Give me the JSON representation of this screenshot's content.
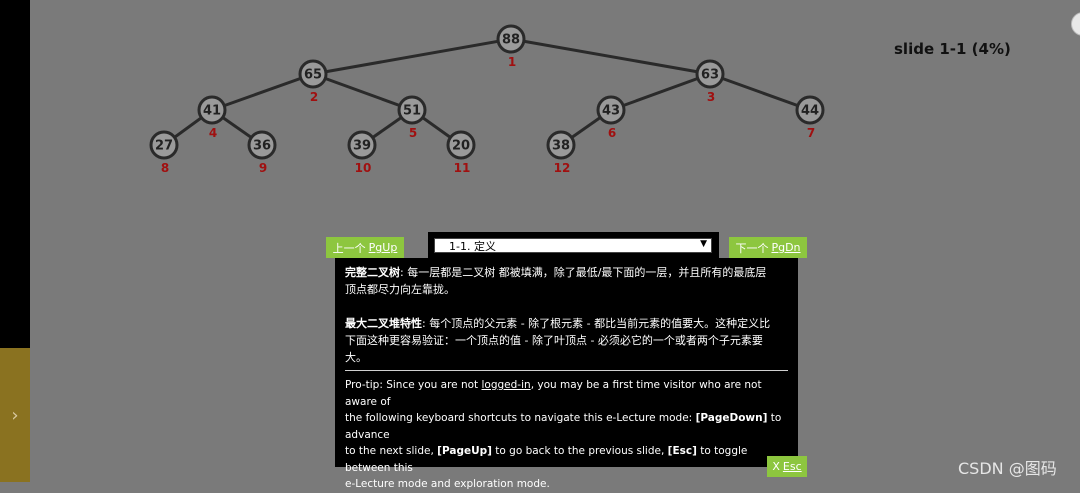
{
  "side_tab": {
    "icon": "chevron-right-icon",
    "glyph": "›"
  },
  "heap": {
    "nodes": [
      {
        "value": "88",
        "index": "1"
      },
      {
        "value": "65",
        "index": "2"
      },
      {
        "value": "63",
        "index": "3"
      },
      {
        "value": "41",
        "index": "4"
      },
      {
        "value": "51",
        "index": "5"
      },
      {
        "value": "43",
        "index": "6"
      },
      {
        "value": "44",
        "index": "7"
      },
      {
        "value": "27",
        "index": "8"
      },
      {
        "value": "36",
        "index": "9"
      },
      {
        "value": "39",
        "index": "10"
      },
      {
        "value": "20",
        "index": "11"
      },
      {
        "value": "38",
        "index": "12"
      }
    ],
    "edges": [
      [
        1,
        2
      ],
      [
        1,
        3
      ],
      [
        2,
        4
      ],
      [
        2,
        5
      ],
      [
        3,
        6
      ],
      [
        3,
        7
      ],
      [
        4,
        8
      ],
      [
        4,
        9
      ],
      [
        5,
        10
      ],
      [
        5,
        11
      ],
      [
        6,
        12
      ]
    ]
  },
  "slide_number": "slide 1-1 (4%)",
  "nav": {
    "prev_label": "上一个",
    "prev_key": "PgUp",
    "next_label": "下一个",
    "next_key": "PgDn",
    "select_value": "1-1. 定义",
    "esc_label": "X",
    "esc_key": "Esc"
  },
  "content": {
    "p1_term": "完整二叉树",
    "p1_line1": ": 每一层都是二叉树 都被填满，除了最低/最下面的一层，并且所有的最底层",
    "p1_line2": "顶点都尽力向左靠拢。",
    "p2_term": "最大二叉堆特性",
    "p2_line1": ": 每个顶点的父元素 - 除了根元素 - 都比当前元素的值要大。这种定义比",
    "p2_line2": "下面这种更容易验证：一个顶点的值 - 除了叶顶点 - 必须必它的一个或者两个子元素要",
    "p2_line3": "大。",
    "tip_line1_a": "Pro-tip: Since you are not ",
    "tip_link": "logged-in",
    "tip_line1_b": ", you may be a first time visitor who are not aware of",
    "tip_line2_a": "the following keyboard shortcuts to navigate this e-Lecture mode: ",
    "tip_key1": "[PageDown]",
    "tip_line2_b": " to advance",
    "tip_line3_a": "to the next slide, ",
    "tip_key2": "[PageUp]",
    "tip_line3_b": " to go back to the previous slide, ",
    "tip_key3": "[Esc]",
    "tip_line3_c": " to toggle between this",
    "tip_line4": "e-Lecture mode and exploration mode."
  },
  "watermark": "CSDN @图码"
}
